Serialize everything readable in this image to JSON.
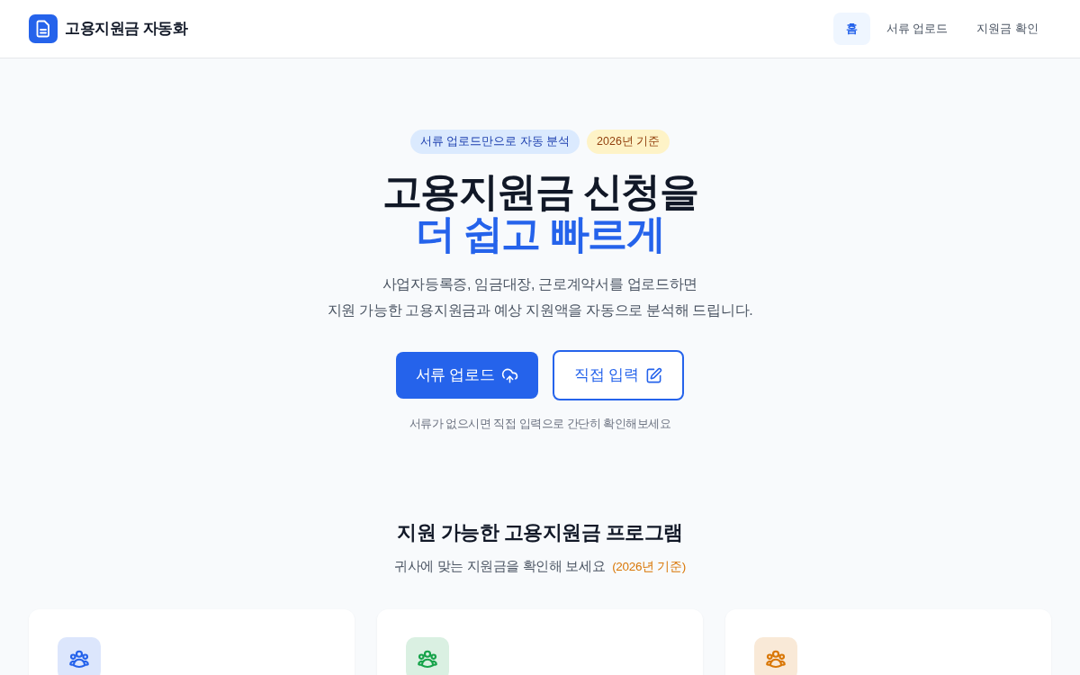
{
  "header": {
    "title": "고용지원금 자동화",
    "nav": [
      {
        "label": "홈",
        "selected": true
      },
      {
        "label": "서류 업로드",
        "selected": false
      },
      {
        "label": "지원금 확인",
        "selected": false
      }
    ]
  },
  "hero": {
    "badges": [
      {
        "label": "서류 업로드만으로 자동 분석",
        "kind": "feature"
      },
      {
        "label": "2026년 기준",
        "kind": "period"
      }
    ],
    "title": "고용지원금 신청을",
    "highlight": "더 쉽고 빠르게",
    "description": [
      "사업자등록증, 임금대장, 근로계약서를 업로드하면",
      "지원 가능한 고용지원금과 예상 지원액을 자동으로 분석해 드립니다."
    ],
    "actions": [
      {
        "label": "서류 업로드",
        "kind": "primary"
      },
      {
        "label": "직접 입력",
        "kind": "secondary"
      }
    ],
    "note": "서류가 없으시면 직접 입력으로 간단히 확인해보세요"
  },
  "programs": {
    "title": "지원 가능한 고용지원금 프로그램",
    "subtitle": "귀사에 맞는 지원금을 확인해 보세요",
    "subtitle_note": "(2026년 기준)",
    "cards": [
      {
        "color": "#2563eb"
      },
      {
        "color": "#16a34a"
      },
      {
        "color": "#d97706"
      }
    ]
  }
}
